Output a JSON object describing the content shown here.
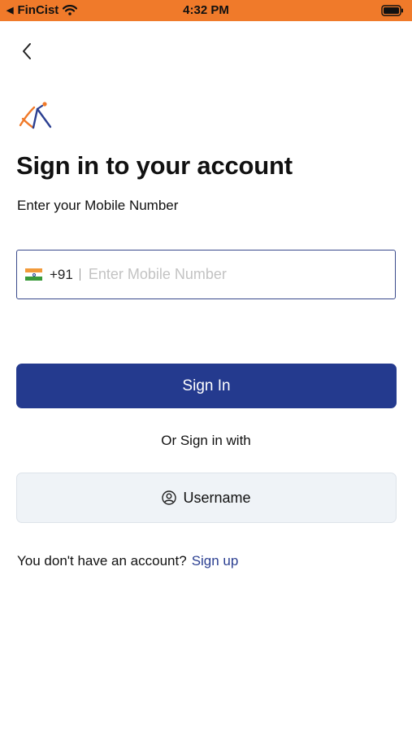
{
  "status_bar": {
    "back_app": "FinCist",
    "time": "4:32 PM",
    "background_color": "#f07a2a"
  },
  "header": {
    "back_icon": "chevron-left-icon"
  },
  "brand": {
    "logo_icon": "fincist-logo-icon"
  },
  "main": {
    "title": "Sign in to your account",
    "subtitle": "Enter your Mobile Number",
    "phone": {
      "flag_icon": "india-flag-icon",
      "country_code": "+91",
      "value": "",
      "placeholder": "Enter Mobile Number"
    },
    "signin_label": "Sign In",
    "or_text": "Or Sign in with",
    "username_icon": "user-circle-icon",
    "username_label": "Username",
    "signup_prompt": "You don't have an account?",
    "signup_link": "Sign up"
  },
  "colors": {
    "primary": "#243a8e",
    "link": "#2b3f91",
    "secondary_button_bg": "#eff3f7",
    "input_border": "#3a4a8c"
  }
}
